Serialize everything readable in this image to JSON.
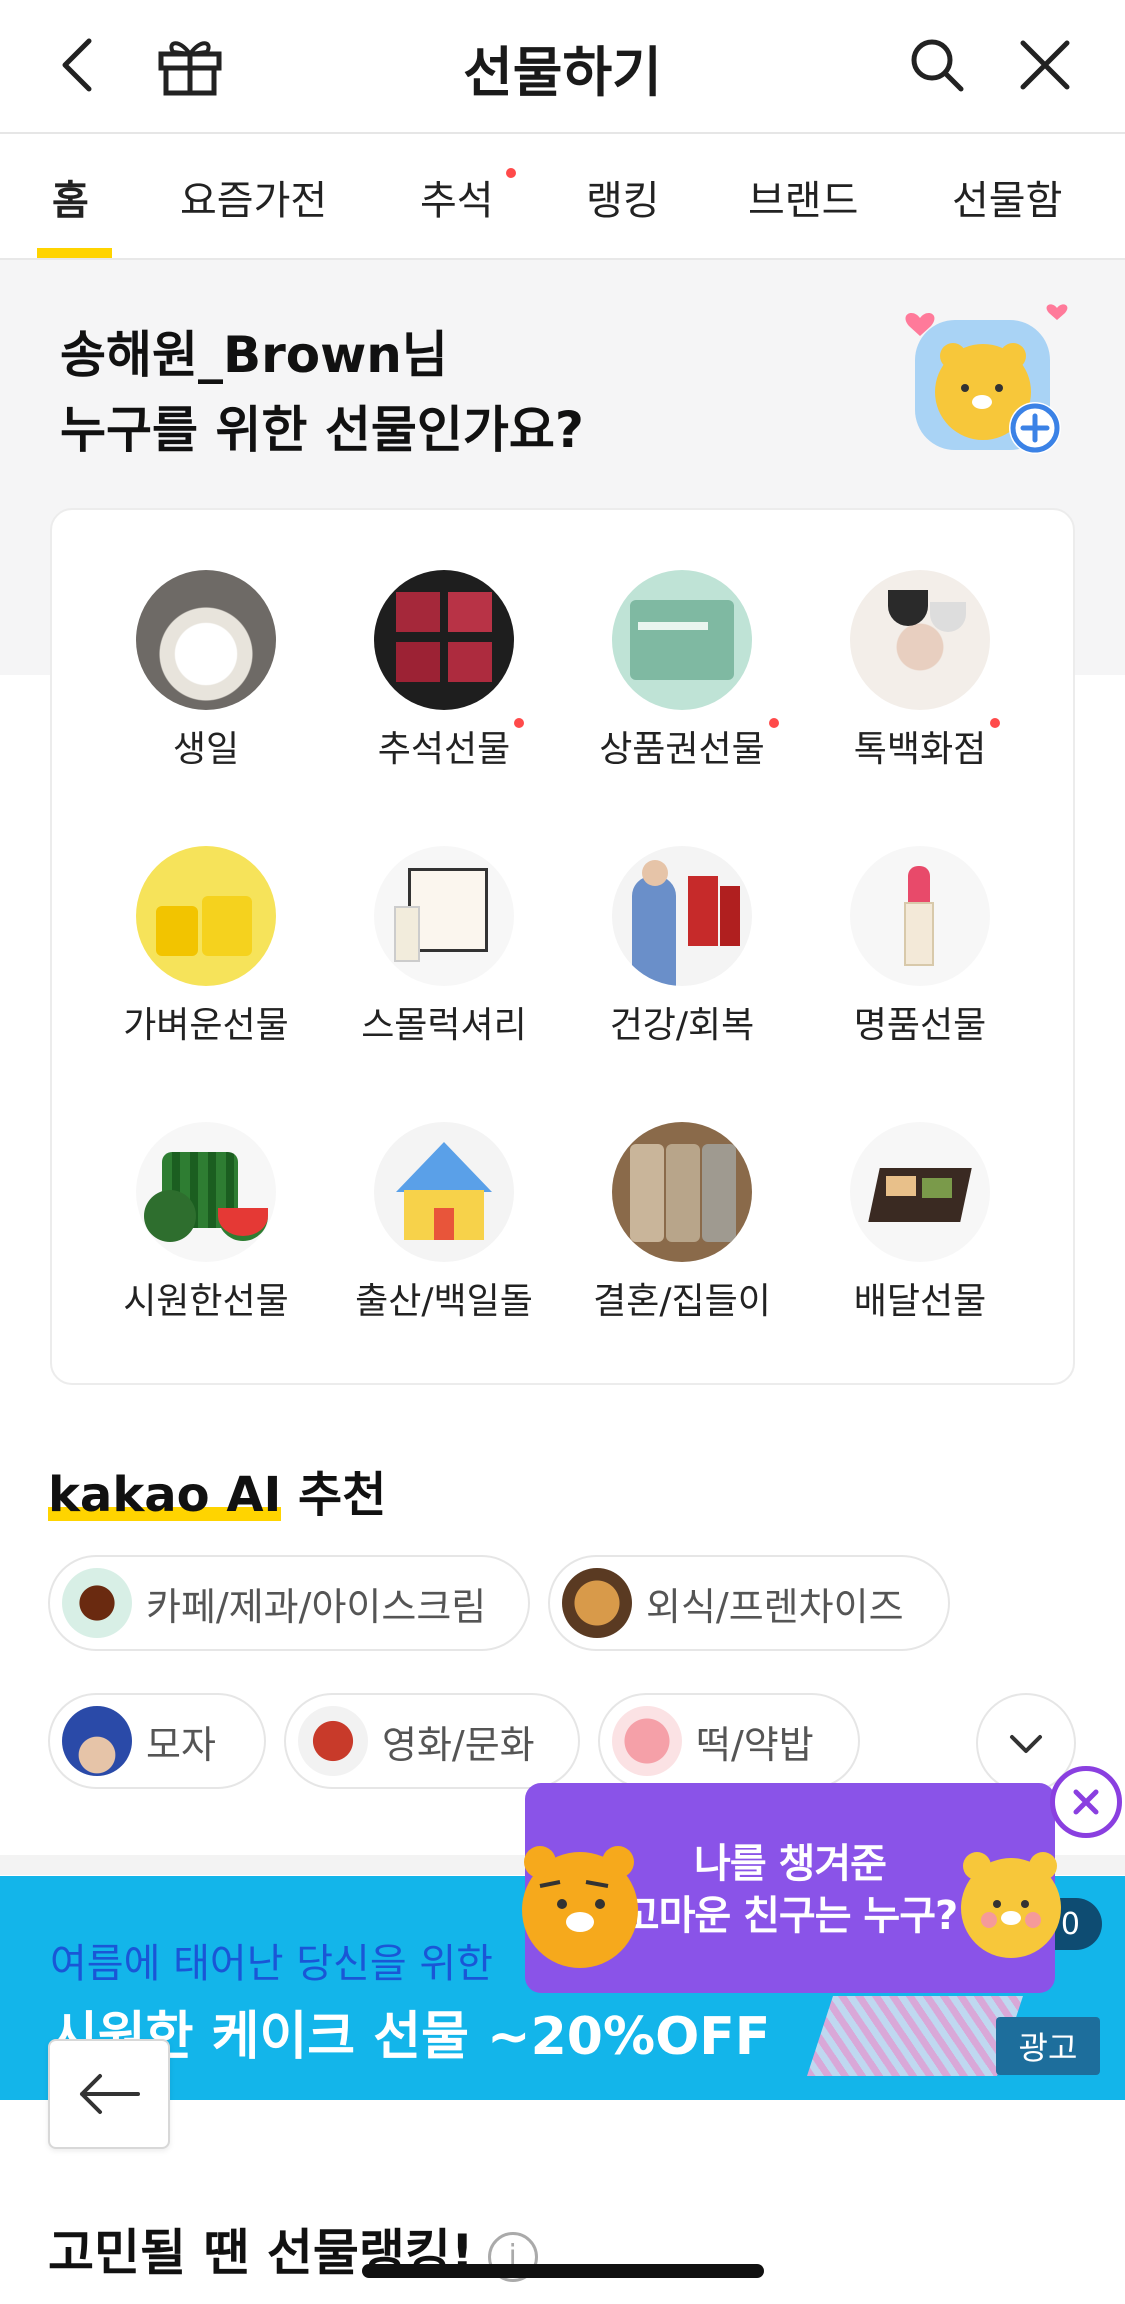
{
  "header": {
    "title": "선물하기"
  },
  "tabs": [
    {
      "label": "홈"
    },
    {
      "label": "요즘가전"
    },
    {
      "label": "추석"
    },
    {
      "label": "랭킹"
    },
    {
      "label": "브랜드"
    },
    {
      "label": "선물함"
    }
  ],
  "greeting": {
    "line1": "송해원_Brown님",
    "line2": "누구를 위한 선물인가요?"
  },
  "categories": [
    {
      "label": "생일"
    },
    {
      "label": "추석선물"
    },
    {
      "label": "상품권선물"
    },
    {
      "label": "톡백화점"
    },
    {
      "label": "가벼운선물"
    },
    {
      "label": "스몰럭셔리"
    },
    {
      "label": "건강/회복"
    },
    {
      "label": "명품선물"
    },
    {
      "label": "시원한선물"
    },
    {
      "label": "출산/백일돌"
    },
    {
      "label": "결혼/집들이"
    },
    {
      "label": "배달선물"
    }
  ],
  "ai": {
    "brand": "kakao AI",
    "title": "추천"
  },
  "chips": [
    {
      "label": "카페/제과/아이스크림"
    },
    {
      "label": "외식/프렌차이즈"
    },
    {
      "label": "모자"
    },
    {
      "label": "영화/문화"
    },
    {
      "label": "떡/약밥"
    }
  ],
  "banner": {
    "subtitle": "여름에 태어난 당신을 위한",
    "title": "시원한 케이크 선물 ~20%OFF",
    "ad_label": "광고",
    "counter": "0"
  },
  "promo": {
    "line1": "나를 챙겨준",
    "line2": "고마운 친구는 누구?"
  },
  "ranking": {
    "title": "고민될 땐 선물랭킹!",
    "info_glyph": "i"
  },
  "colors": {
    "accent": "#ffd400",
    "banner": "#13b5ea",
    "promo": "#8a53e8",
    "dot": "#ff4a4a"
  }
}
